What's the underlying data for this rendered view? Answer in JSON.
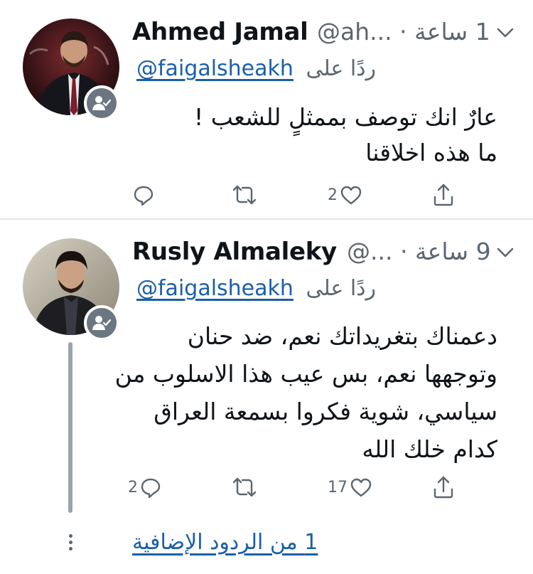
{
  "tweets": [
    {
      "author_name": "Ahmed Jamal",
      "handle": "@ah...",
      "separator": "·",
      "time": "1 ساعة",
      "replying_label": "ردًا على",
      "replying_to": "@faigalsheakh",
      "text_lines": [
        "عارٌ انك توصف بممثلٍ للشعب !",
        "ما هذه اخلاقنا"
      ],
      "reply_count": "",
      "retweet_count": "",
      "like_count": "2",
      "avatar_icon": "profile-photo",
      "badge_icon": "follow-person-check-icon"
    },
    {
      "author_name": "Rusly Almaleky",
      "handle": "@...",
      "separator": "·",
      "time": "9 ساعة",
      "replying_label": "ردًا على",
      "replying_to": "@faigalsheakh",
      "text_lines": [
        "دعمناك بتغريداتك نعم، ضد حنان",
        "وتوجهها نعم، بس عيب هذا الاسلوب من",
        "سياسي، شوية فكروا بسمعة العراق",
        "كدام خلك الله"
      ],
      "reply_count": "2",
      "retweet_count": "",
      "like_count": "17",
      "avatar_icon": "profile-photo",
      "badge_icon": "follow-person-check-icon"
    }
  ],
  "thread": {
    "more_replies_label": "1 من الردود الإضافية"
  },
  "colors": {
    "text": "#0f1419",
    "secondary": "#5b6670",
    "link": "#1b5fa8",
    "divider": "#e1e6ea",
    "badge": "#6b7681",
    "thread_line": "#9aa4ae"
  }
}
